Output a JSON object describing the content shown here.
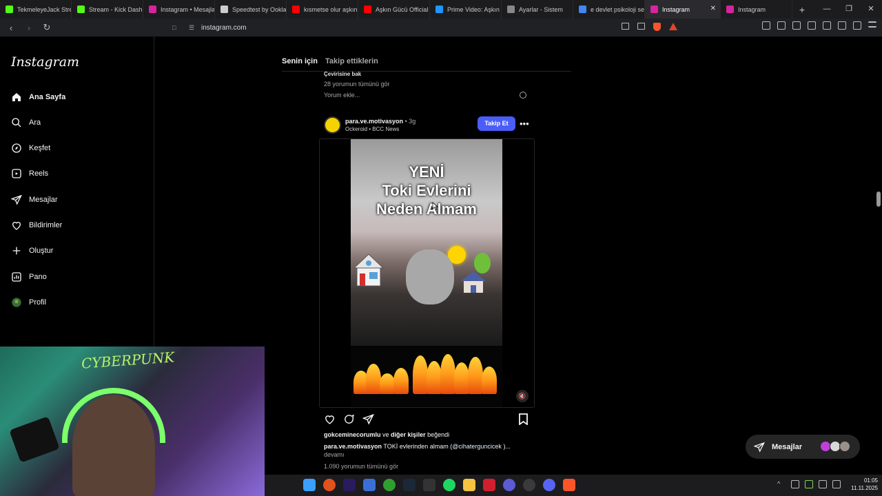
{
  "browser": {
    "tabs": [
      {
        "label": "TekmeleyeJack Strea",
        "color": "#53fc18"
      },
      {
        "label": "Stream - Kick Dashb",
        "color": "#53fc18"
      },
      {
        "label": "Instagram • Mesajla",
        "color": "#d6249f"
      },
      {
        "label": "Speedtest by Ookla",
        "color": "#cccccc"
      },
      {
        "label": "kısmetse olur aşkın",
        "color": "#ff0000"
      },
      {
        "label": "Aşkın Gücü Official",
        "color": "#ff0000"
      },
      {
        "label": "Prime Video: Aşkın G",
        "color": "#1a98ff"
      },
      {
        "label": "Ayarlar - Sistem",
        "color": "#888888"
      },
      {
        "label": "e devlet psikoloji se",
        "color": "#4285f4"
      },
      {
        "label": "Instagram",
        "color": "#d6249f",
        "active": true
      },
      {
        "label": "Instagram",
        "color": "#d6249f"
      }
    ],
    "new_tab_icon": "plus-icon",
    "url": "instagram.com"
  },
  "sidebar": {
    "logo": "Instagram",
    "items": [
      {
        "label": "Ana Sayfa",
        "icon": "home-icon",
        "active": true
      },
      {
        "label": "Ara",
        "icon": "search-icon"
      },
      {
        "label": "Keşfet",
        "icon": "compass-icon"
      },
      {
        "label": "Reels",
        "icon": "reels-icon"
      },
      {
        "label": "Mesajlar",
        "icon": "send-icon"
      },
      {
        "label": "Bildirimler",
        "icon": "heart-icon"
      },
      {
        "label": "Oluştur",
        "icon": "plus-icon"
      },
      {
        "label": "Pano",
        "icon": "dashboard-icon"
      },
      {
        "label": "Profil",
        "icon": "profile-avatar"
      }
    ]
  },
  "feed": {
    "tab_for_you": "Senin için",
    "tab_following": "Takip ettiklerin",
    "previous_post": {
      "translation": "Çevirisine bak",
      "view_comments": "28 yorumun tümünü gör",
      "add_comment": "Yorum ekle..."
    },
    "post": {
      "username": "para.ve.motivasyon",
      "time": "3g",
      "audio": "Ockeroid • BCC News",
      "follow_label": "Takip Et",
      "video_title_lines": [
        "YENİ",
        "Toki Evlerini",
        "Neden Almam"
      ],
      "likes_user": "gokceminecorumlu",
      "likes_connector": " ve ",
      "likes_others": "diğer kişiler",
      "likes_suffix": " beğendi",
      "caption_user": "para.ve.motivasyon",
      "caption_text": " TOKİ evlerinden almam (",
      "caption_mention": "@cihaterguncicek",
      "caption_end": " )...",
      "more_label": "devamı",
      "view_comments": "1.090 yorumun tümünü gör"
    }
  },
  "messages_pill": {
    "label": "Mesajlar"
  },
  "webcam": {
    "poster_text": "CYBERPUNK"
  },
  "system": {
    "time": "01:05",
    "date": "11.11.2025"
  }
}
